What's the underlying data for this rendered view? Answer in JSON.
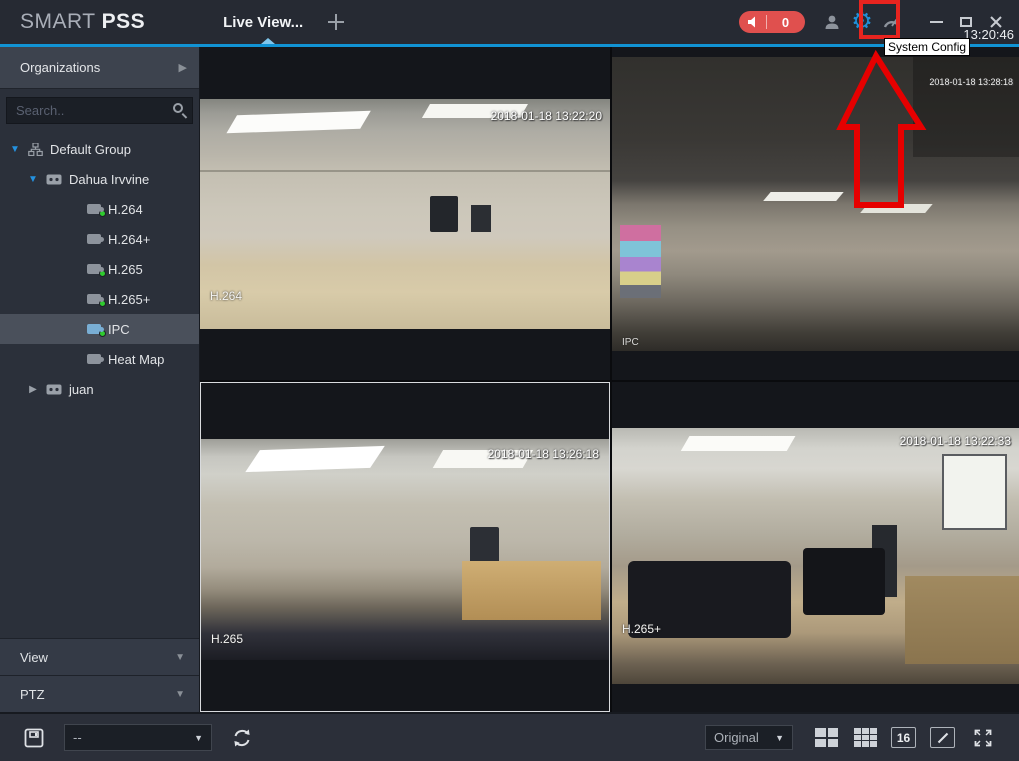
{
  "titlebar": {
    "brand_smart": "SMART ",
    "brand_pss": "PSS",
    "tab_live_view": "Live View...",
    "alarm_count": "0",
    "clock": "13:20:46"
  },
  "tooltip": {
    "system_config": "System Config"
  },
  "sidebar": {
    "organizations_label": "Organizations",
    "search_placeholder": "Search..",
    "tree": [
      {
        "label": "Default Group"
      },
      {
        "label": "Dahua Irvvine"
      },
      {
        "label": "H.264"
      },
      {
        "label": "H.264+"
      },
      {
        "label": "H.265"
      },
      {
        "label": "H.265+"
      },
      {
        "label": "IPC"
      },
      {
        "label": "Heat Map"
      },
      {
        "label": "juan"
      }
    ],
    "view_label": "View",
    "ptz_label": "PTZ"
  },
  "cameras": [
    {
      "name": "H.264",
      "timestamp": "2018-01-18 13:22:20"
    },
    {
      "name": "IPC",
      "timestamp": "2018-01-18 13:28:18"
    },
    {
      "name": "H.265",
      "timestamp": "2018-01-18 13:26:18"
    },
    {
      "name": "H.265+",
      "timestamp": "2018-01-18 13:22:33"
    }
  ],
  "toolbar": {
    "view_dropdown_value": "--",
    "scale_dropdown_value": "Original",
    "split_16_label": "16"
  },
  "icons": {
    "gear": "⚙",
    "dropdown_arrow": "▼",
    "expander_expanded": "▼",
    "expander_collapsed": "▶",
    "panel_arrow": "▼",
    "org_arrow": "▶"
  },
  "colors": {
    "accent_blue": "#1193d4",
    "annotation_red": "#e60000",
    "alarm_pill_red": "#e0504e",
    "online_green": "#2fcb2f",
    "gear_blue": "#1f8fd8"
  }
}
